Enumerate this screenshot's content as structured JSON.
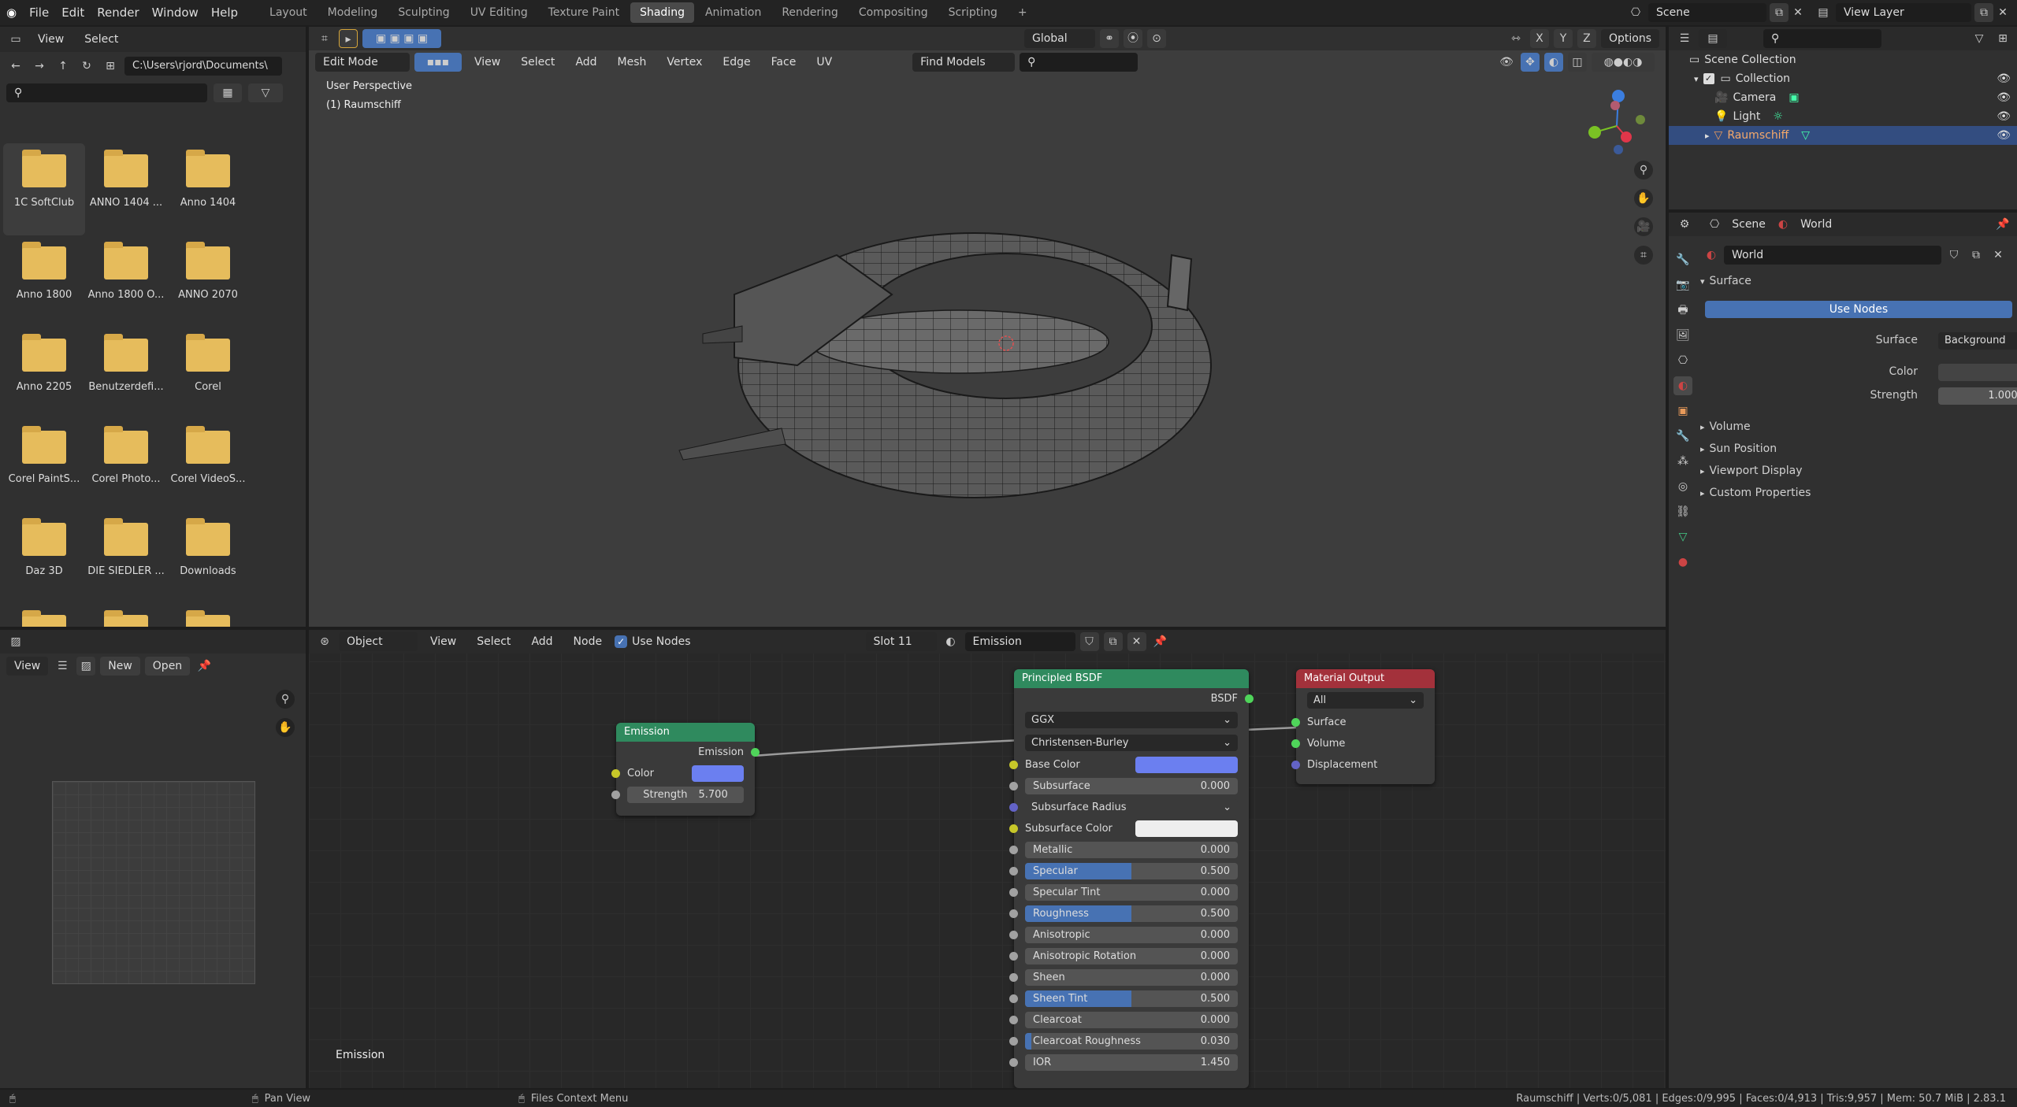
{
  "topbar": {
    "menus": [
      "File",
      "Edit",
      "Render",
      "Window",
      "Help"
    ],
    "workspaces": [
      "Layout",
      "Modeling",
      "Sculpting",
      "UV Editing",
      "Texture Paint",
      "Shading",
      "Animation",
      "Rendering",
      "Compositing",
      "Scripting"
    ],
    "active_workspace": "Shading",
    "add_tab": "+",
    "scene": "Scene",
    "view_layer": "View Layer"
  },
  "file_browser": {
    "menus": [
      "View",
      "Select"
    ],
    "path": "C:\\Users\\rjord\\Documents\\",
    "folders": [
      "1C SoftClub",
      "ANNO 1404 ...",
      "Anno 1404",
      "Anno 1800",
      "Anno 1800 O...",
      "ANNO 2070",
      "Anno 2205",
      "Benutzerdefi...",
      "Corel",
      "Corel PaintS...",
      "Corel Photo...",
      "Corel VideoS...",
      "Daz 3D",
      "DIE SIEDLER ...",
      "Downloads",
      "",
      "",
      ""
    ]
  },
  "image_editor": {
    "view": "View",
    "new": "New",
    "open": "Open"
  },
  "viewport": {
    "mode": "Edit Mode",
    "menus": [
      "View",
      "Select",
      "Add",
      "Mesh",
      "Vertex",
      "Edge",
      "Face",
      "UV"
    ],
    "orientation": "Global",
    "find_models": "Find Models",
    "perspective": "User Perspective",
    "object_label": "(1) Raumschiff",
    "options": "Options",
    "xyz": [
      "X",
      "Y",
      "Z"
    ]
  },
  "node_editor": {
    "type": "Object",
    "menus": [
      "View",
      "Select",
      "Add",
      "Node"
    ],
    "use_nodes": "Use Nodes",
    "slot": "Slot 11",
    "material": "Emission",
    "footer_label": "Emission",
    "emission_node": {
      "title": "Emission",
      "output": "Emission",
      "color_label": "Color",
      "strength_label": "Strength",
      "strength_value": "5.700",
      "color": "#6b7ff0"
    },
    "bsdf_node": {
      "title": "Principled BSDF",
      "output": "BSDF",
      "distribution": "GGX",
      "subsurface_method": "Christensen-Burley",
      "base_color_label": "Base Color",
      "subsurface_radius": "Subsurface Radius",
      "subsurface_color_label": "Subsurface Color",
      "fields": [
        {
          "label": "Subsurface",
          "value": "0.000",
          "fill": 0
        },
        {
          "label": "Metallic",
          "value": "0.000",
          "fill": 0
        },
        {
          "label": "Specular",
          "value": "0.500",
          "fill": 0.5
        },
        {
          "label": "Specular Tint",
          "value": "0.000",
          "fill": 0
        },
        {
          "label": "Roughness",
          "value": "0.500",
          "fill": 0.5
        },
        {
          "label": "Anisotropic",
          "value": "0.000",
          "fill": 0
        },
        {
          "label": "Anisotropic Rotation",
          "value": "0.000",
          "fill": 0
        },
        {
          "label": "Sheen",
          "value": "0.000",
          "fill": 0
        },
        {
          "label": "Sheen Tint",
          "value": "0.500",
          "fill": 0.5
        },
        {
          "label": "Clearcoat",
          "value": "0.000",
          "fill": 0
        },
        {
          "label": "Clearcoat Roughness",
          "value": "0.030",
          "fill": 0.03
        },
        {
          "label": "IOR",
          "value": "1.450",
          "fill": 0
        }
      ]
    },
    "output_node": {
      "title": "Material Output",
      "target": "All",
      "inputs": [
        "Surface",
        "Volume",
        "Displacement"
      ]
    }
  },
  "outliner": {
    "root": "Scene Collection",
    "collection": "Collection",
    "items": [
      "Camera",
      "Light",
      "Raumschiff"
    ]
  },
  "properties": {
    "scene": "Scene",
    "world_tab": "World",
    "world_name": "World",
    "panel_surface": "Surface",
    "use_nodes": "Use Nodes",
    "surface_label": "Surface",
    "surface_value": "Background",
    "color_label": "Color",
    "strength_label": "Strength",
    "strength_value": "1.000",
    "collapsed_panels": [
      "Volume",
      "Sun Position",
      "Viewport Display",
      "Custom Properties"
    ]
  },
  "statusbar": {
    "pan": "Pan View",
    "context": "Files Context Menu",
    "stats": "Raumschiff | Verts:0/5,081 | Edges:0/9,995 | Faces:0/4,913 | Tris:9,957 | Mem: 50.7 MiB | 2.83.1"
  },
  "colors": {
    "accent": "#4772b3",
    "node_green": "#2f8a5e",
    "node_red": "#a3313b",
    "socket_green": "#4fd45a",
    "socket_yellow": "#c7c729",
    "socket_grey": "#a1a1a1",
    "socket_purple": "#6363c7"
  }
}
